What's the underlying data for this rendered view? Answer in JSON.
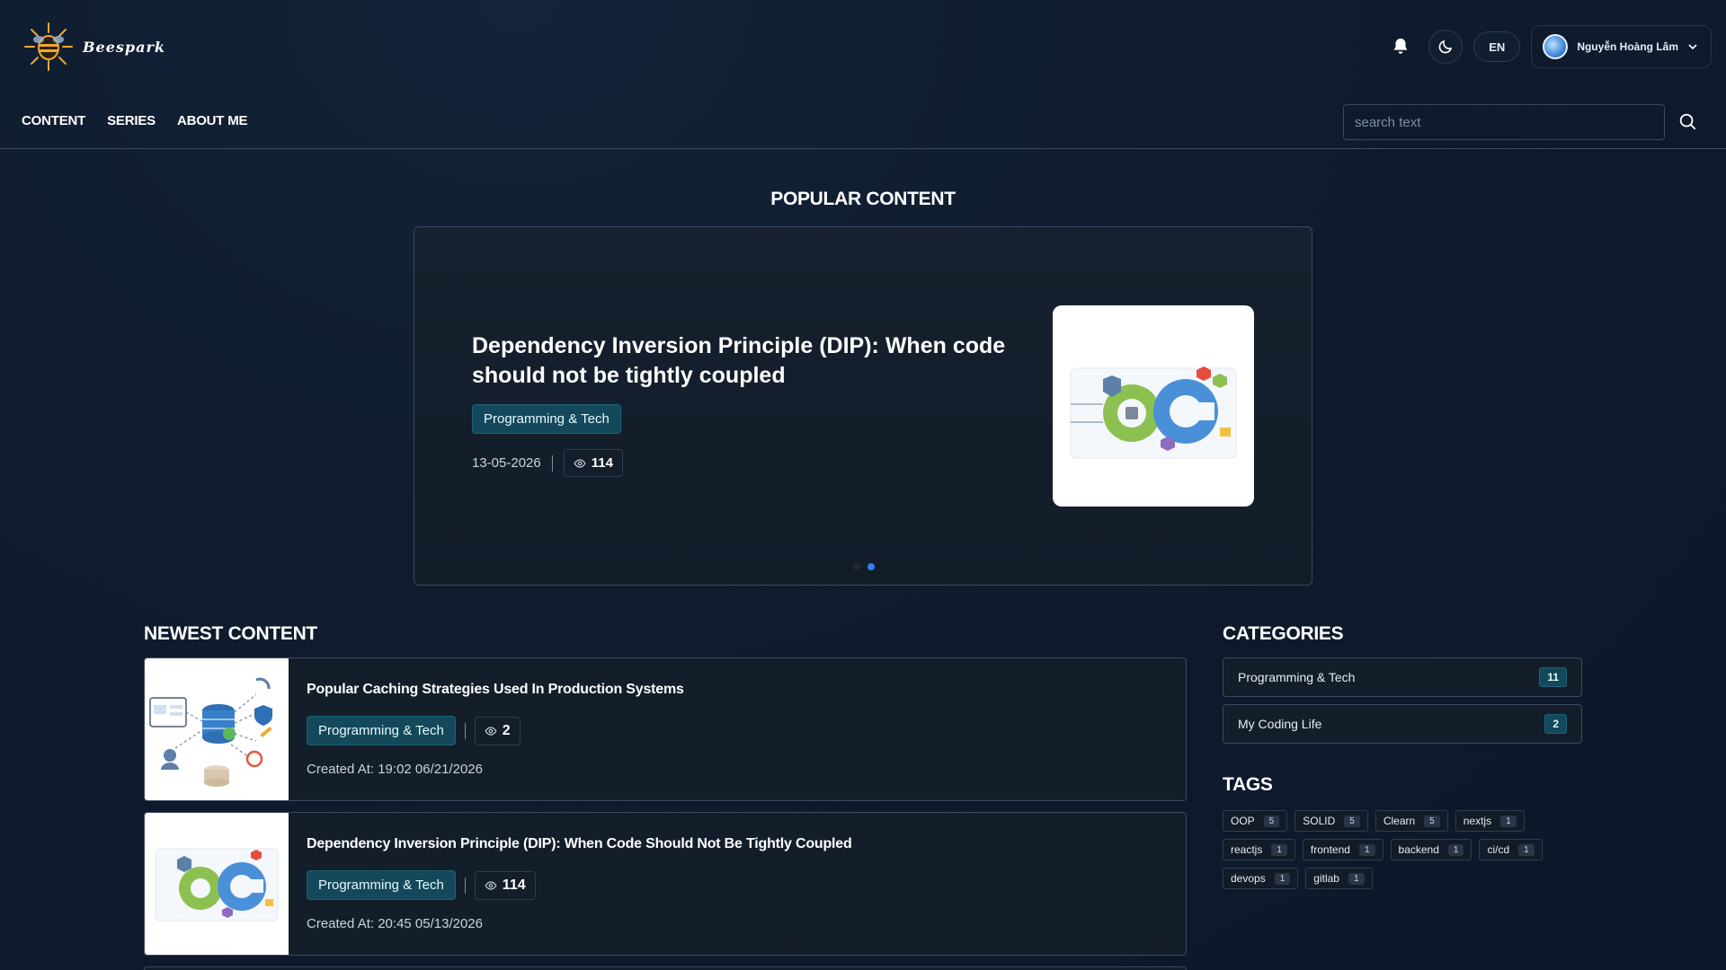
{
  "brand": {
    "name": "Beespark"
  },
  "nav": {
    "items": [
      "CONTENT",
      "SERIES",
      "ABOUT ME"
    ]
  },
  "header": {
    "language": "EN",
    "user_name": "Nguyễn Hoàng Lâm",
    "search_placeholder": "search text"
  },
  "popular": {
    "section_title": "POPULAR CONTENT",
    "title": "Dependency Inversion Principle (DIP): When code should not be tightly coupled",
    "category": "Programming & Tech",
    "date": "13-05-2026",
    "views": "114",
    "slide_count": 2,
    "active_slide": 2
  },
  "newest": {
    "section_title": "NEWEST CONTENT",
    "items": [
      {
        "title": "Popular Caching Strategies Used In Production Systems",
        "category": "Programming & Tech",
        "views": "2",
        "created": "Created At: 19:02 06/21/2026"
      },
      {
        "title": "Dependency Inversion Principle (DIP): When Code Should Not Be Tightly Coupled",
        "category": "Programming & Tech",
        "views": "114",
        "created": "Created At: 20:45 05/13/2026"
      }
    ]
  },
  "categories": {
    "section_title": "CATEGORIES",
    "items": [
      {
        "name": "Programming & Tech",
        "count": "11"
      },
      {
        "name": "My Coding Life",
        "count": "2"
      }
    ]
  },
  "tags": {
    "section_title": "TAGS",
    "items": [
      {
        "name": "OOP",
        "count": "5"
      },
      {
        "name": "SOLID",
        "count": "5"
      },
      {
        "name": "Clearn",
        "count": "5"
      },
      {
        "name": "nextjs",
        "count": "1"
      },
      {
        "name": "reactjs",
        "count": "1"
      },
      {
        "name": "frontend",
        "count": "1"
      },
      {
        "name": "backend",
        "count": "1"
      },
      {
        "name": "ci/cd",
        "count": "1"
      },
      {
        "name": "devops",
        "count": "1"
      },
      {
        "name": "gitlab",
        "count": "1"
      }
    ]
  },
  "colors": {
    "accent": "#2d7ff9",
    "chip_bg": "#13495a",
    "border": "#3a4a60"
  }
}
